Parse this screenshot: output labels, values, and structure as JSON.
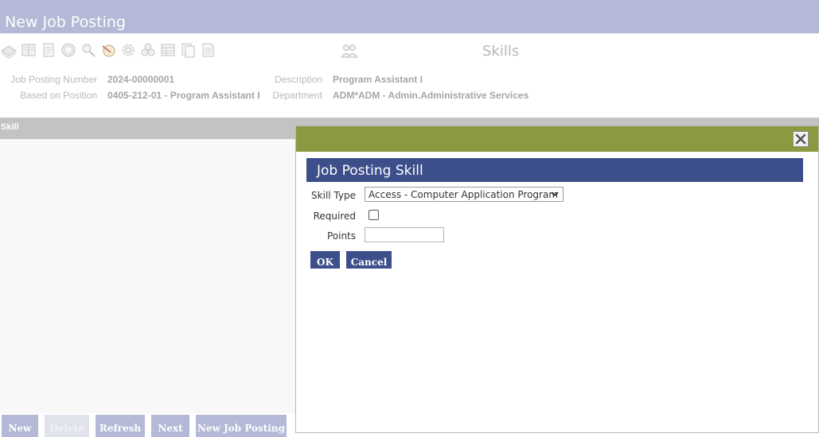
{
  "window": {
    "title": "New Job Posting"
  },
  "toolbar": {
    "icons": [
      "layers-icon",
      "book-icon",
      "document-icon",
      "circle-icon",
      "search-person-icon",
      "edit-icon",
      "gear-icon",
      "group-icon",
      "table-icon",
      "copy-icon",
      "notes-icon"
    ],
    "section_icon": "people-icon",
    "section_title": "Skills"
  },
  "info": {
    "job_posting_number_label": "Job Posting Number",
    "job_posting_number": "2024-00000001",
    "based_on_position_label": "Based on Position",
    "based_on_position": "0405-212-01 - Program Assistant I",
    "description_label": "Description",
    "description": "Program Assistant I",
    "department_label": "Department",
    "department": "ADM*ADM - Admin.Administrative Services"
  },
  "grid": {
    "columns": [
      "Skill"
    ]
  },
  "bottom_buttons": {
    "new": "New",
    "delete": "Delete",
    "refresh": "Refresh",
    "next": "Next",
    "new_job_posting": "New Job Posting"
  },
  "modal": {
    "title": "Job Posting Skill",
    "skill_type_label": "Skill Type",
    "skill_type_value": "Access - Computer Application Program",
    "required_label": "Required",
    "required_checked": false,
    "points_label": "Points",
    "points_value": "",
    "ok_label": "OK",
    "cancel_label": "Cancel"
  },
  "colors": {
    "title_bar": "#b3b9d6",
    "modal_bar": "#8a9a40",
    "modal_heading": "#3d4f8a",
    "grid_header": "#c3c3c3"
  }
}
